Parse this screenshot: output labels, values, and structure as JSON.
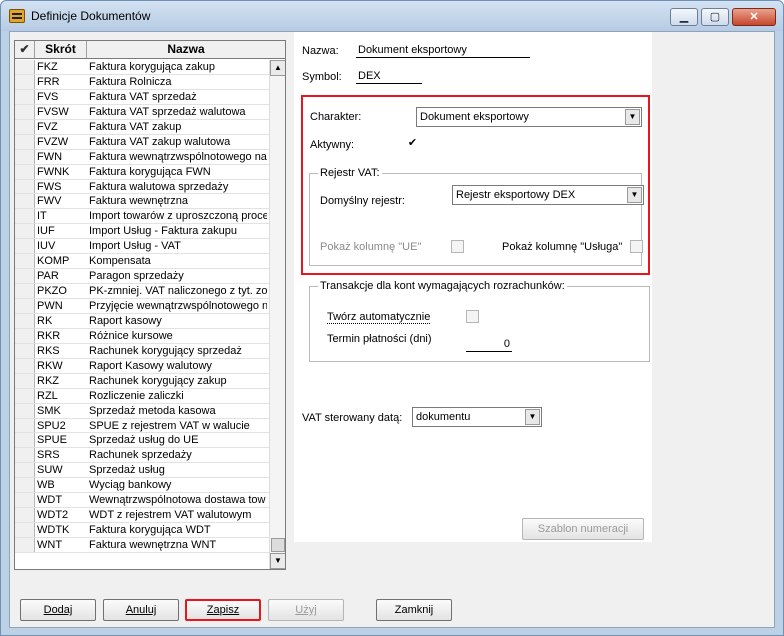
{
  "window": {
    "title": "Definicje Dokumentów"
  },
  "list": {
    "headers": {
      "check": "✔",
      "skrot": "Skrót",
      "nazwa": "Nazwa"
    },
    "rows": [
      {
        "skrot": "FKZ",
        "nazwa": "Faktura korygująca zakup"
      },
      {
        "skrot": "FRR",
        "nazwa": "Faktura Rolnicza"
      },
      {
        "skrot": "FVS",
        "nazwa": "Faktura VAT sprzedaż"
      },
      {
        "skrot": "FVSW",
        "nazwa": "Faktura VAT sprzedaż walutowa"
      },
      {
        "skrot": "FVZ",
        "nazwa": "Faktura VAT zakup"
      },
      {
        "skrot": "FVZW",
        "nazwa": "Faktura VAT zakup walutowa"
      },
      {
        "skrot": "FWN",
        "nazwa": "Faktura wewnątrzwspólnotowego na"
      },
      {
        "skrot": "FWNK",
        "nazwa": "Faktura korygująca FWN"
      },
      {
        "skrot": "FWS",
        "nazwa": "Faktura walutowa sprzedaży"
      },
      {
        "skrot": "FWV",
        "nazwa": "Faktura wewnętrzna"
      },
      {
        "skrot": "IT",
        "nazwa": "Import towarów z uproszczoną proce"
      },
      {
        "skrot": "IUF",
        "nazwa": "Import Usług - Faktura zakupu"
      },
      {
        "skrot": "IUV",
        "nazwa": "Import Usług - VAT"
      },
      {
        "skrot": "KOMP",
        "nazwa": "Kompensata"
      },
      {
        "skrot": "PAR",
        "nazwa": "Paragon sprzedaży"
      },
      {
        "skrot": "PKZO",
        "nazwa": "PK-zmniej. VAT naliczonego z tyt. zob"
      },
      {
        "skrot": "PWN",
        "nazwa": "Przyjęcie wewnątrzwspólnotowego n"
      },
      {
        "skrot": "RK",
        "nazwa": "Raport kasowy"
      },
      {
        "skrot": "RKR",
        "nazwa": "Różnice kursowe"
      },
      {
        "skrot": "RKS",
        "nazwa": "Rachunek korygujący sprzedaż"
      },
      {
        "skrot": "RKW",
        "nazwa": "Raport Kasowy walutowy"
      },
      {
        "skrot": "RKZ",
        "nazwa": "Rachunek korygujący zakup"
      },
      {
        "skrot": "RZL",
        "nazwa": "Rozliczenie zaliczki"
      },
      {
        "skrot": "SMK",
        "nazwa": "Sprzedaż metoda kasowa"
      },
      {
        "skrot": "SPU2",
        "nazwa": "SPUE z rejestrem VAT w walucie"
      },
      {
        "skrot": "SPUE",
        "nazwa": "Sprzedaż usług do UE"
      },
      {
        "skrot": "SRS",
        "nazwa": "Rachunek sprzedaży"
      },
      {
        "skrot": "SUW",
        "nazwa": "Sprzedaż usług"
      },
      {
        "skrot": "WB",
        "nazwa": "Wyciąg bankowy"
      },
      {
        "skrot": "WDT",
        "nazwa": "Wewnątrzwspólnotowa dostawa tow"
      },
      {
        "skrot": "WDT2",
        "nazwa": "WDT z rejestrem VAT walutowym"
      },
      {
        "skrot": "WDTK",
        "nazwa": "Faktura korygująca WDT"
      },
      {
        "skrot": "WNT",
        "nazwa": "Faktura wewnętrzna WNT"
      }
    ]
  },
  "form": {
    "nazwa_label": "Nazwa:",
    "nazwa_value": "Dokument eksportowy",
    "symbol_label": "Symbol:",
    "symbol_value": "DEX",
    "charakter_label": "Charakter:",
    "charakter_value": "Dokument eksportowy",
    "aktywny_label": "Aktywny:",
    "aktywny_checked": true,
    "rejestr_group": "Rejestr VAT:",
    "domyslny_label": "Domyślny rejestr:",
    "domyslny_value": "Rejestr eksportowy DEX",
    "pokaz_ue_label": "Pokaż kolumnę \"UE\"",
    "pokaz_usluga_label": "Pokaż kolumnę \"Usługa\"",
    "transakcje_group": "Transakcje dla kont wymagających rozrachunków:",
    "tworz_label": "Twórz automatycznie",
    "termin_label": "Termin płatności (dni)",
    "termin_value": "0",
    "vat_label": "VAT sterowany datą:",
    "vat_value": "dokumentu",
    "szablon_button": "Szablon numeracji"
  },
  "buttons": {
    "dodaj": "Dodaj",
    "anuluj": "Anuluj",
    "zapisz": "Zapisz",
    "uzyj": "Użyj",
    "zamknij": "Zamknij"
  },
  "colors": {
    "highlight": "#e8161c",
    "window_frame": "#bcd0e6"
  }
}
